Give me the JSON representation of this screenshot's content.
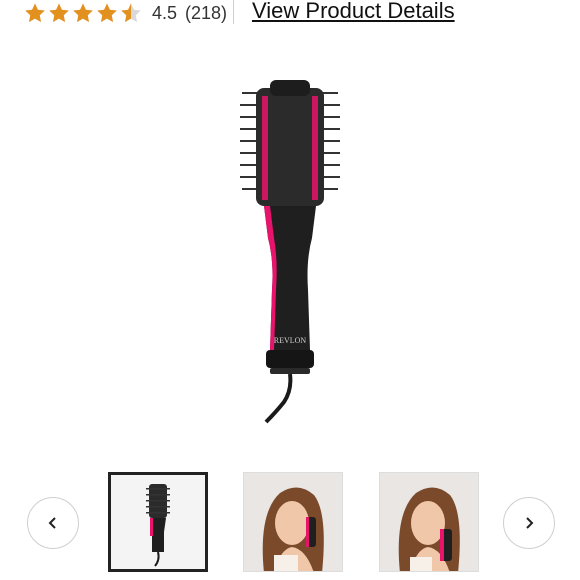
{
  "rating": {
    "value": "4.5",
    "count": "(218)",
    "stars_filled": 4.5,
    "stars_total": 5,
    "star_color": "#e2901e"
  },
  "details_link": "View Product Details",
  "product": {
    "brand_on_handle": "REVLON",
    "accent_color": "#e8136b"
  },
  "gallery": {
    "selected_index": 0,
    "thumbnails": [
      "brush-image",
      "model-image",
      "model-image"
    ],
    "prev_icon": "chevron-left-icon",
    "next_icon": "chevron-right-icon"
  }
}
